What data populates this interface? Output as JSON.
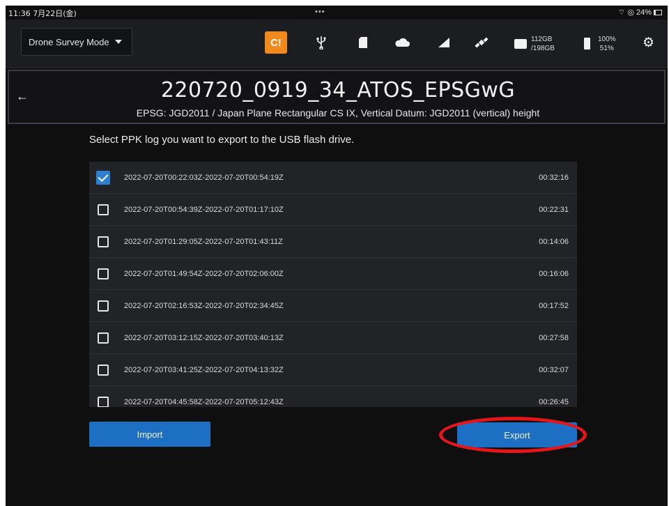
{
  "statusbar": {
    "time": "11:36  7月22日(金)",
    "dots": "•••",
    "wifi_battery": "⌔ ◎ 24%"
  },
  "toolbar": {
    "mode_label": "Drone Survey Mode",
    "icons": [
      "alert-icon",
      "usb-icon",
      "sd-card-icon",
      "cloud-icon",
      "signal-icon",
      "satellite-icon"
    ],
    "storage": {
      "used": "112GB",
      "total": "/198GB"
    },
    "battery": {
      "level1": "100%",
      "level2": "51%"
    },
    "alert_color": "#f08a1c"
  },
  "header": {
    "title": "220720_0919_34_ATOS_EPSGwG",
    "subtitle": "EPSG: JGD2011 / Japan Plane Rectangular CS IX, Vertical Datum: JGD2011 (vertical) height"
  },
  "instruction": "Select PPK log you want to export to the USB flash drive.",
  "logs": [
    {
      "range": "2022-07-20T00:22:03Z-2022-07-20T00:54:19Z",
      "duration": "00:32:16",
      "checked": true
    },
    {
      "range": "2022-07-20T00:54:39Z-2022-07-20T01:17:10Z",
      "duration": "00:22:31",
      "checked": false
    },
    {
      "range": "2022-07-20T01:29:05Z-2022-07-20T01:43:11Z",
      "duration": "00:14:06",
      "checked": false
    },
    {
      "range": "2022-07-20T01:49:54Z-2022-07-20T02:06:00Z",
      "duration": "00:16:06",
      "checked": false
    },
    {
      "range": "2022-07-20T02:16:53Z-2022-07-20T02:34:45Z",
      "duration": "00:17:52",
      "checked": false
    },
    {
      "range": "2022-07-20T03:12:15Z-2022-07-20T03:40:13Z",
      "duration": "00:27:58",
      "checked": false
    },
    {
      "range": "2022-07-20T03:41:25Z-2022-07-20T04:13:32Z",
      "duration": "00:32:07",
      "checked": false
    },
    {
      "range": "2022-07-20T04:45:58Z-2022-07-20T05:12:43Z",
      "duration": "00:26:45",
      "checked": false
    }
  ],
  "buttons": {
    "import_label": "Import",
    "export_label": "Export"
  },
  "colors": {
    "accent": "#1d6fc4",
    "highlight": "#e4161c",
    "background": "#0f0f10"
  }
}
